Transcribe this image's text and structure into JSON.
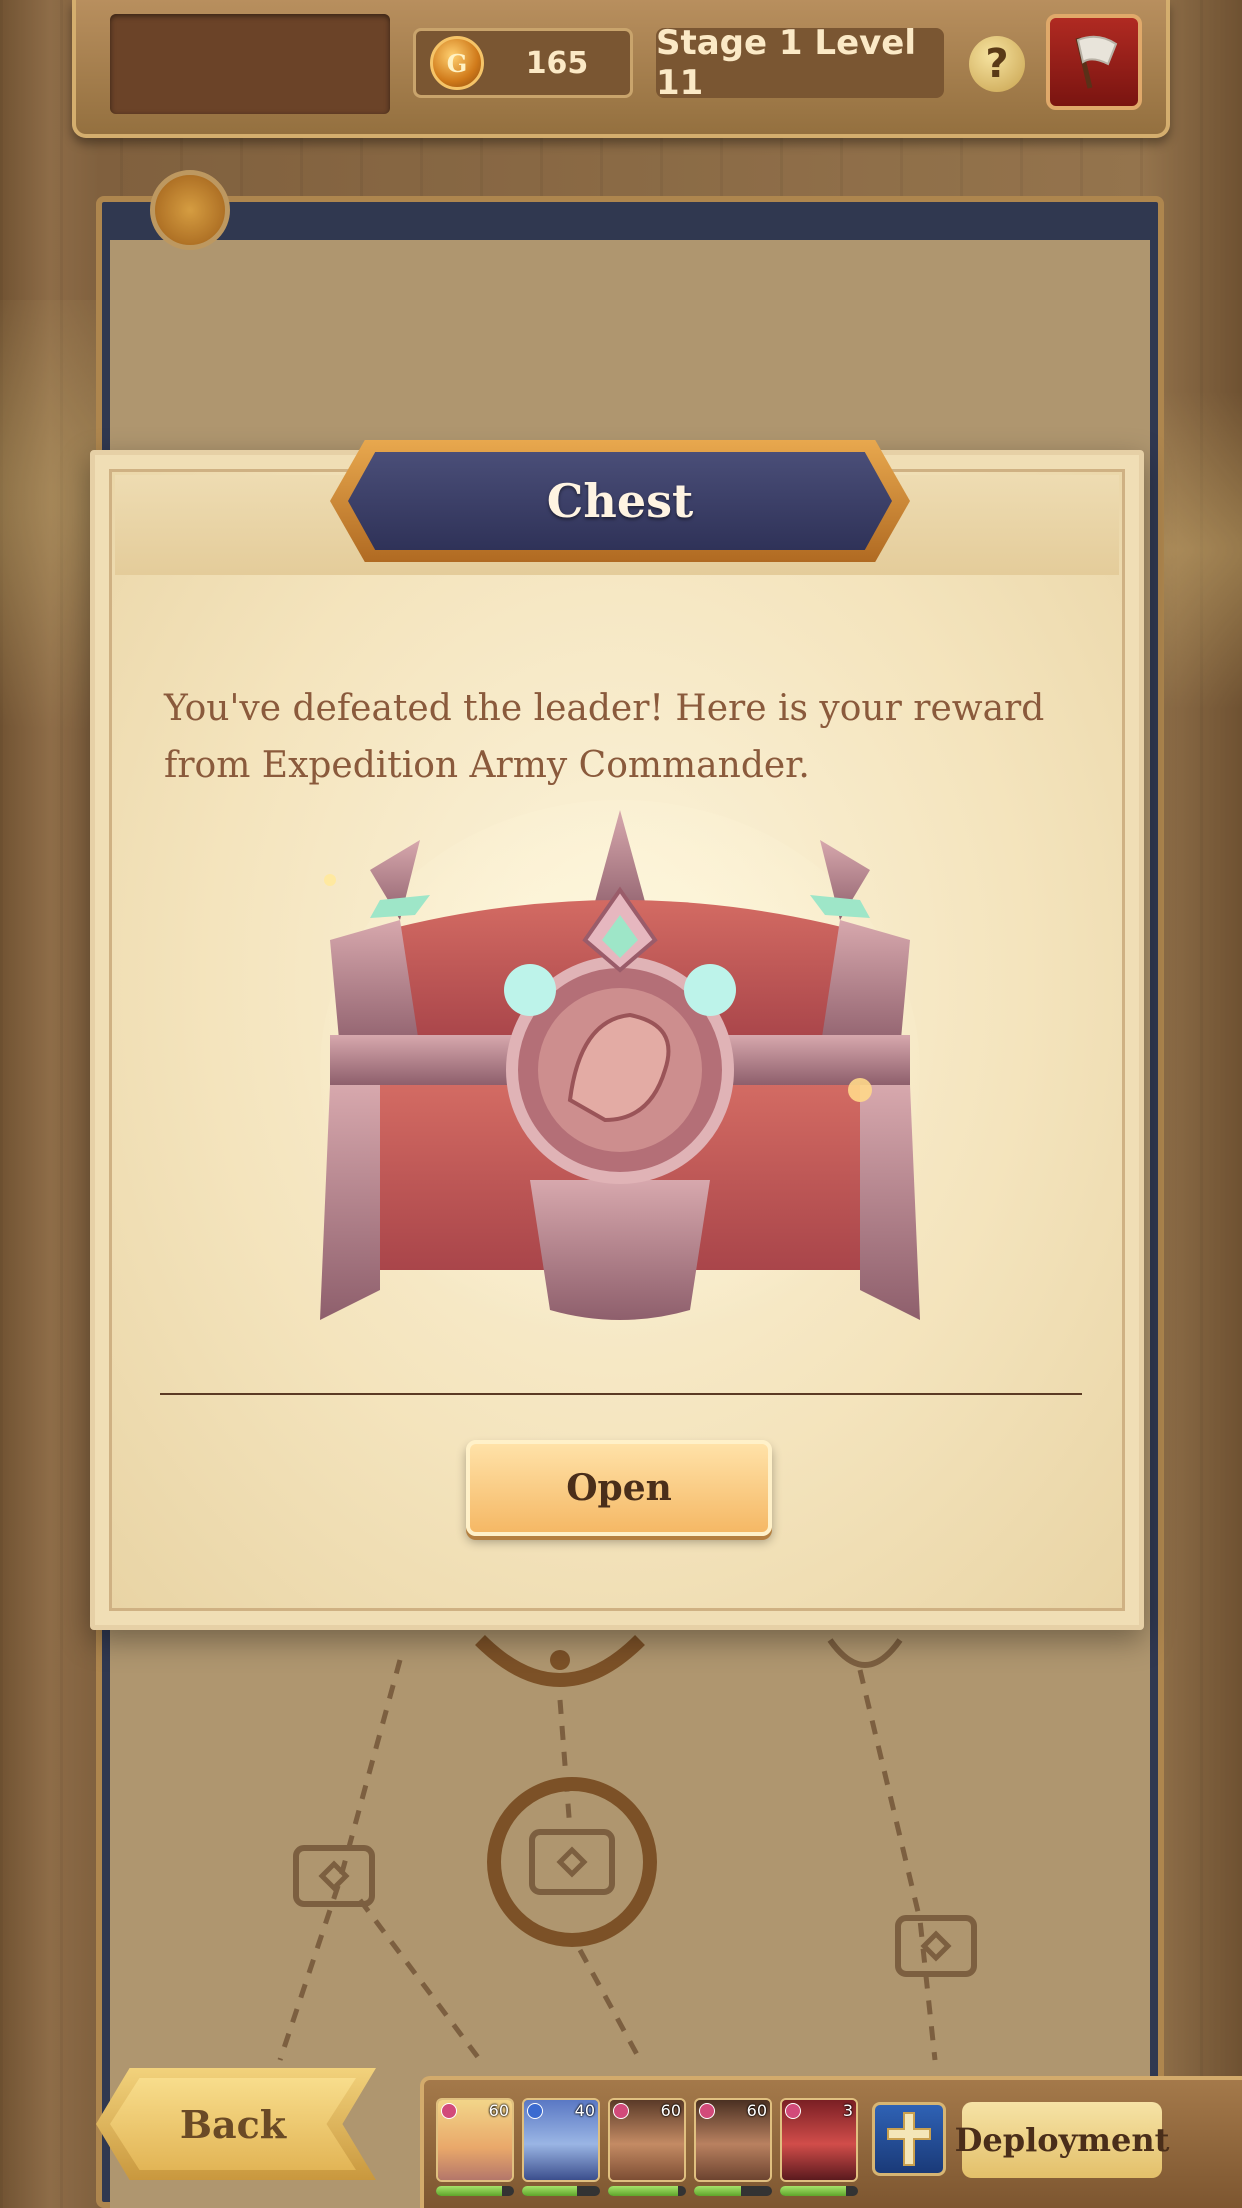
{
  "top_bar": {
    "coins": "165",
    "coin_symbol": "G",
    "stage_label": "Stage 1 Level 11",
    "help_label": "?"
  },
  "dialog": {
    "title": "Chest",
    "message": "You've defeated the leader! Here is your reward from Expedition Army Commander.",
    "open_label": "Open"
  },
  "bottom_bar": {
    "back_label": "Back",
    "deploy_label": "Deployment",
    "heroes": [
      {
        "level": "60",
        "hp": 0.85
      },
      {
        "level": "40",
        "hp": 0.7
      },
      {
        "level": "60",
        "hp": 0.9
      },
      {
        "level": "60",
        "hp": 0.6
      },
      {
        "level": "3",
        "hp": 0.85
      }
    ]
  },
  "colors": {
    "accent_gold": "#e3c06a",
    "title_plate": "#3a3d66",
    "message_text": "#8a5a3c"
  },
  "icons": [
    "coin-icon",
    "help-icon",
    "flag-icon",
    "chest-icon",
    "skill-icon"
  ]
}
